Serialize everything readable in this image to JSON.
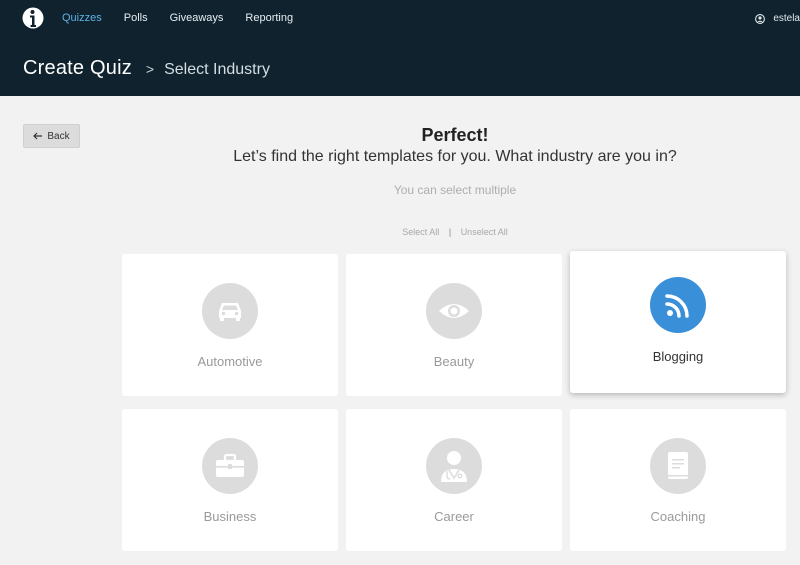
{
  "nav": {
    "items": [
      {
        "label": "Quizzes",
        "active": true
      },
      {
        "label": "Polls",
        "active": false
      },
      {
        "label": "Giveaways",
        "active": false
      },
      {
        "label": "Reporting",
        "active": false
      }
    ],
    "user_name": "estela"
  },
  "header": {
    "title": "Create Quiz",
    "separator": ">",
    "subtitle": "Select Industry"
  },
  "back_button": {
    "label": "Back"
  },
  "intro": {
    "headline": "Perfect!",
    "question": "Let’s find the right templates for you. What industry are you in?",
    "hint": "You can select multiple"
  },
  "selection": {
    "select_all": "Select All",
    "divider": "|",
    "unselect_all": "Unselect All"
  },
  "industries": [
    {
      "label": "Automotive",
      "icon": "car-icon",
      "selected": false
    },
    {
      "label": "Beauty",
      "icon": "eye-icon",
      "selected": false
    },
    {
      "label": "Blogging",
      "icon": "rss-icon",
      "selected": true
    },
    {
      "label": "Business",
      "icon": "briefcase-icon",
      "selected": false
    },
    {
      "label": "Career",
      "icon": "doctor-icon",
      "selected": false
    },
    {
      "label": "Coaching",
      "icon": "book-icon",
      "selected": false
    }
  ],
  "colors": {
    "topbar": "#0f222d",
    "nav_active": "#5eb2e8",
    "selected_icon_bg": "#3a8fd9",
    "icon_bg": "#dcdcdc"
  }
}
